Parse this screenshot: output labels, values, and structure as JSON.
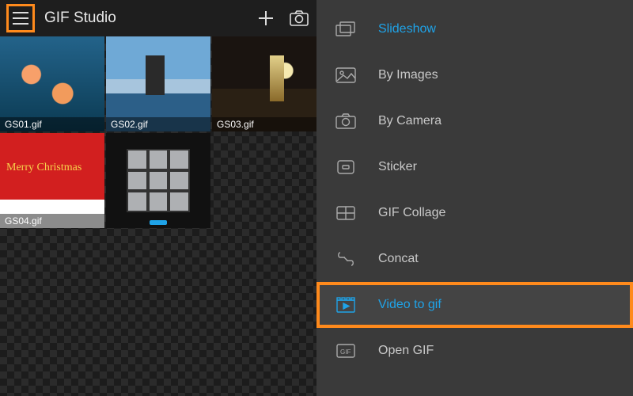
{
  "app": {
    "title": "GIF Studio"
  },
  "gallery": {
    "items": [
      {
        "filename": "GS01.gif"
      },
      {
        "filename": "GS02.gif"
      },
      {
        "filename": "GS03.gif"
      },
      {
        "filename": "GS04.gif",
        "overlay_text": "Merry Christmas"
      },
      {
        "filename": ""
      }
    ]
  },
  "menu": {
    "items": [
      {
        "label": "Slideshow",
        "icon": "slideshow-icon",
        "highlight": "alt"
      },
      {
        "label": "By Images",
        "icon": "images-icon"
      },
      {
        "label": "By Camera",
        "icon": "camera-icon"
      },
      {
        "label": "Sticker",
        "icon": "sticker-icon"
      },
      {
        "label": "GIF Collage",
        "icon": "collage-icon"
      },
      {
        "label": "Concat",
        "icon": "concat-icon"
      },
      {
        "label": "Video to gif",
        "icon": "video-icon",
        "selected": true
      },
      {
        "label": "Open GIF",
        "icon": "open-gif-icon"
      }
    ]
  },
  "colors": {
    "accent": "#ff8a1c",
    "link": "#1fa3e8"
  }
}
